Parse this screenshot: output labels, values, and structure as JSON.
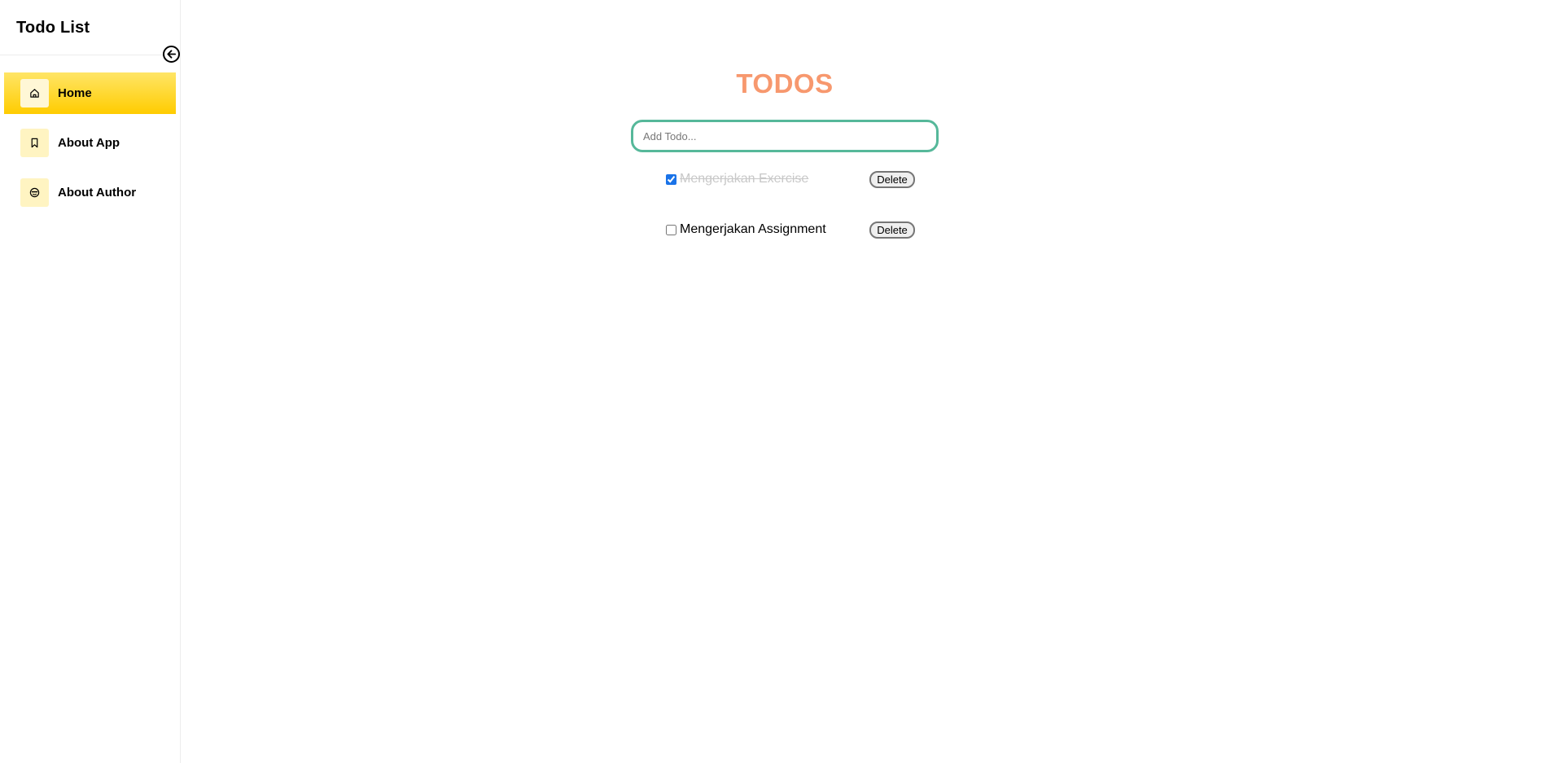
{
  "sidebar": {
    "title": "Todo List",
    "items": [
      {
        "label": "Home",
        "icon": "home-icon",
        "active": true
      },
      {
        "label": "About App",
        "icon": "bookmark-icon",
        "active": false
      },
      {
        "label": "About Author",
        "icon": "face-icon",
        "active": false
      }
    ]
  },
  "main": {
    "title": "TODOS",
    "input_placeholder": "Add Todo...",
    "todos": [
      {
        "text": "Mengerjakan Exercise",
        "completed": true,
        "delete_label": "Delete"
      },
      {
        "text": "Mengerjakan Assignment",
        "completed": false,
        "delete_label": "Delete"
      }
    ]
  },
  "colors": {
    "accent_yellow": "#ffcc00",
    "title_orange": "#f7986e",
    "input_border": "#56b89a"
  }
}
